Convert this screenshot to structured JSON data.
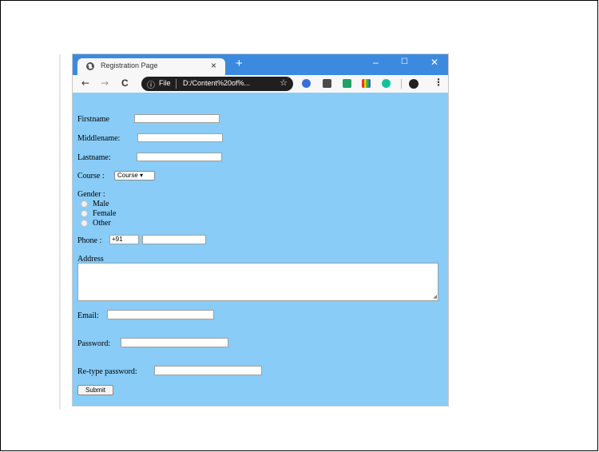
{
  "browser": {
    "tab_title": "Registration Page",
    "tab_close": "×",
    "new_tab": "+",
    "minimize": "–",
    "maximize": "☐",
    "close": "✕",
    "back": "←",
    "forward": "→",
    "reload": "C",
    "info": "ⓘ",
    "scheme_label": "File",
    "url": "D:/Content%20of%...",
    "star": "☆",
    "menu": "⋮",
    "icons": [
      "globe-icon",
      "back-icon",
      "forward-icon",
      "reload-icon",
      "info-icon",
      "star-icon",
      "extension-icon",
      "gmail-icon",
      "sheets-icon",
      "bars-icon",
      "grammarly-icon",
      "profile-icon",
      "menu-icon"
    ],
    "colors": {
      "titlebar": "#3c8ae0",
      "page_background": "#88ccf7",
      "omnibox": "#1f1f1f"
    }
  },
  "form": {
    "firstname_label": "Firstname",
    "middlename_label": "Middlename:",
    "lastname_label": "Lastname:",
    "course_label": "Course :",
    "course_selected": "Course ▾",
    "gender_label": "Gender :",
    "gender_options": [
      "Male",
      "Female",
      "Other"
    ],
    "phone_label": "Phone :",
    "phone_code": "+91",
    "address_label": "Address",
    "email_label": "Email:",
    "password_label": "Password:",
    "retype_label": "Re-type password:",
    "submit_label": "Submit"
  }
}
